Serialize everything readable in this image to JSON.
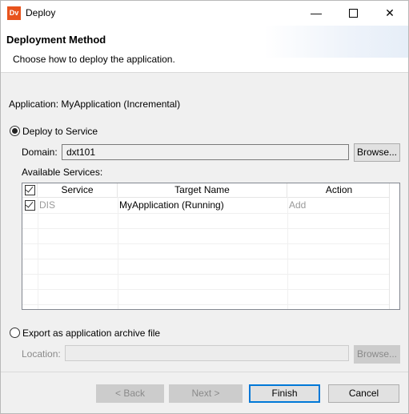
{
  "window": {
    "title": "Deploy",
    "icon_text": "Dv",
    "controls": {
      "minimize": "—",
      "close": "✕"
    }
  },
  "header": {
    "title": "Deployment Method",
    "description": "Choose how to deploy the application."
  },
  "application_label": "Application: MyApplication (Incremental)",
  "deploy_to_service": {
    "label": "Deploy to Service",
    "selected": true,
    "domain_label": "Domain:",
    "domain_value": "dxt101",
    "browse_label": "Browse...",
    "services_label": "Available Services:",
    "table": {
      "columns": [
        "Service",
        "Target Name",
        "Action"
      ],
      "rows": [
        {
          "checked": true,
          "service": "DIS",
          "target_name": "MyApplication (Running)",
          "action": "Add"
        }
      ]
    }
  },
  "export_archive": {
    "label": "Export as application archive file",
    "selected": false,
    "location_label": "Location:",
    "location_value": "",
    "browse_label": "Browse..."
  },
  "buttons": {
    "back": "< Back",
    "next": "Next >",
    "finish": "Finish",
    "cancel": "Cancel"
  },
  "colors": {
    "accent": "#0078d7",
    "icon_bg": "#e8531d",
    "disabled_text": "#8a8a8a",
    "muted_cell_text": "#9a9a9a"
  }
}
